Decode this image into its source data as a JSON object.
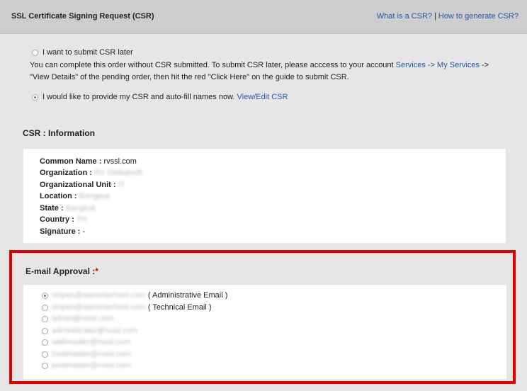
{
  "header": {
    "title": "SSL Certificate Signing Request (CSR)",
    "link_what": "What is a CSR?",
    "separator": "|",
    "link_how": "How to generate CSR?"
  },
  "options": {
    "later": {
      "label": "I want to submit CSR later",
      "checked": false,
      "desc_part1": "You can complete this order without CSR submitted. To submit CSR later, please acccess to your account ",
      "desc_link": "Services -> My Services",
      "desc_part2": " -> \"View Details\" of the pending order, then hit the red \"Click Here\" on the guide to submit CSR."
    },
    "now": {
      "label": "I would like to provide my CSR and auto-fill names now.",
      "checked": true,
      "link": "View/Edit CSR"
    }
  },
  "csr": {
    "title": "CSR : Information",
    "fields": [
      {
        "label": "Common Name :",
        "value": "rvssl.com",
        "blurred": false
      },
      {
        "label": "Organization :",
        "value": "RV Globalsoft",
        "blurred": true
      },
      {
        "label": "Organizational Unit :",
        "value": "IT",
        "blurred": true
      },
      {
        "label": "Location :",
        "value": "Bangpue",
        "blurred": true
      },
      {
        "label": "State :",
        "value": "Bangkok",
        "blurred": true
      },
      {
        "label": "Country :",
        "value": "TH",
        "blurred": true
      },
      {
        "label": "Signature :",
        "value": "-",
        "blurred": false
      }
    ]
  },
  "email_approval": {
    "title": "E-mail Approval :",
    "required_mark": "*",
    "options": [
      {
        "email": "siripen@siaminterhost.com",
        "suffix": " ( Administrative Email )",
        "checked": true
      },
      {
        "email": "siripen@siaminterhost.com",
        "suffix": " ( Technical Email )",
        "checked": false
      },
      {
        "email": "admin@rvssl.com",
        "suffix": "",
        "checked": false
      },
      {
        "email": "administrator@rvssl.com",
        "suffix": "",
        "checked": false
      },
      {
        "email": "webmaster@rvssl.com",
        "suffix": "",
        "checked": false
      },
      {
        "email": "hostmaster@rvssl.com",
        "suffix": "",
        "checked": false
      },
      {
        "email": "postmaster@rvssl.com",
        "suffix": "",
        "checked": false
      }
    ]
  },
  "colors": {
    "link": "#1f58a8",
    "highlight_border": "#e00000",
    "required": "#d90000"
  }
}
